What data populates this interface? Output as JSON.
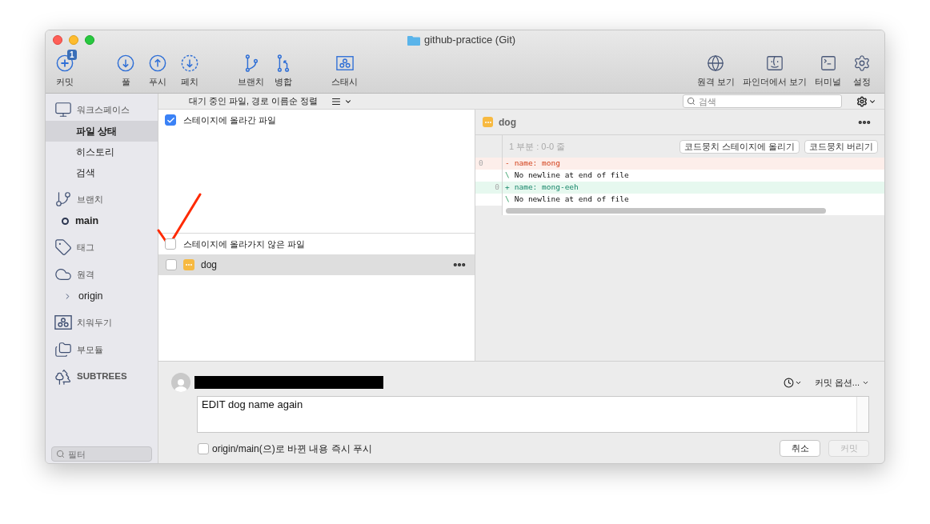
{
  "window": {
    "title": "github-practice (Git)"
  },
  "toolbar": {
    "left_groups": [
      [
        {
          "kind": "commit",
          "label": "커밋",
          "badge": "1"
        }
      ],
      [
        {
          "kind": "pull",
          "label": "풀"
        },
        {
          "kind": "push",
          "label": "푸시"
        },
        {
          "kind": "fetch",
          "label": "페치"
        }
      ],
      [
        {
          "kind": "branch",
          "label": "브랜치"
        },
        {
          "kind": "merge",
          "label": "병합"
        }
      ],
      [
        {
          "kind": "stash",
          "label": "스태시"
        }
      ]
    ],
    "right": [
      {
        "kind": "globe",
        "label": "원격 보기"
      },
      {
        "kind": "finder",
        "label": "파인더에서 보기"
      },
      {
        "kind": "terminal",
        "label": "터미널"
      },
      {
        "kind": "settings",
        "label": "설정"
      }
    ]
  },
  "sidebar": {
    "sections": [
      {
        "kind": "workspace",
        "label": "워크스페이스",
        "children": [
          {
            "kind": "view",
            "label": "파일 상태",
            "selected": true
          },
          {
            "kind": "view",
            "label": "히스토리",
            "selected": false
          },
          {
            "kind": "view",
            "label": "검색",
            "selected": false
          }
        ]
      },
      {
        "kind": "branch",
        "label": "브랜치",
        "children": [
          {
            "kind": "branch",
            "label": "main",
            "current": true
          }
        ]
      },
      {
        "kind": "tag",
        "label": "태그"
      },
      {
        "kind": "remote",
        "label": "원격",
        "children": [
          {
            "kind": "remote",
            "label": "origin",
            "expanded": false
          }
        ]
      },
      {
        "kind": "stash",
        "label": "치워두기"
      },
      {
        "kind": "submodule",
        "label": "부모듈"
      },
      {
        "kind": "subtree",
        "label": "SUBTREES"
      }
    ],
    "filter": {
      "placeholder": "필터"
    }
  },
  "file_bar": {
    "sort_label": "대기 중인 파일, 경로 이름순 정렬",
    "search": {
      "placeholder": "검색"
    }
  },
  "staged": {
    "label": "스테이지에 올라간 파일",
    "checked": true
  },
  "unstaged": {
    "label": "스테이지에 올라가지 않은 파일",
    "checked": false,
    "files": [
      {
        "name": "dog",
        "checked": false,
        "selected": true
      }
    ]
  },
  "diff": {
    "file": "dog",
    "hunk_header": "1 부분 : 0-0 줄",
    "hunk_buttons": [
      "코드뭉치 스테이지에 올리기",
      "코드뭉치 버리기"
    ],
    "lines": [
      {
        "kind": "removed",
        "old": "0",
        "sign": "-",
        "text": "name: mong"
      },
      {
        "kind": "note",
        "sign": "\\",
        "text": "No newline at end of file"
      },
      {
        "kind": "added",
        "new": "0",
        "sign": "+",
        "text": "name: mong-eeh"
      },
      {
        "kind": "note",
        "sign": "\\",
        "text": "No newline at end of file"
      }
    ]
  },
  "commit": {
    "options": "커밋 옵션...",
    "message": "EDIT dog name again",
    "push": {
      "label": "origin/main(으)로 바뀐 내용 즉시 푸시",
      "checked": false
    },
    "buttons": [
      {
        "label": "취소",
        "disabled": false
      },
      {
        "label": "커밋",
        "disabled": true
      }
    ]
  }
}
